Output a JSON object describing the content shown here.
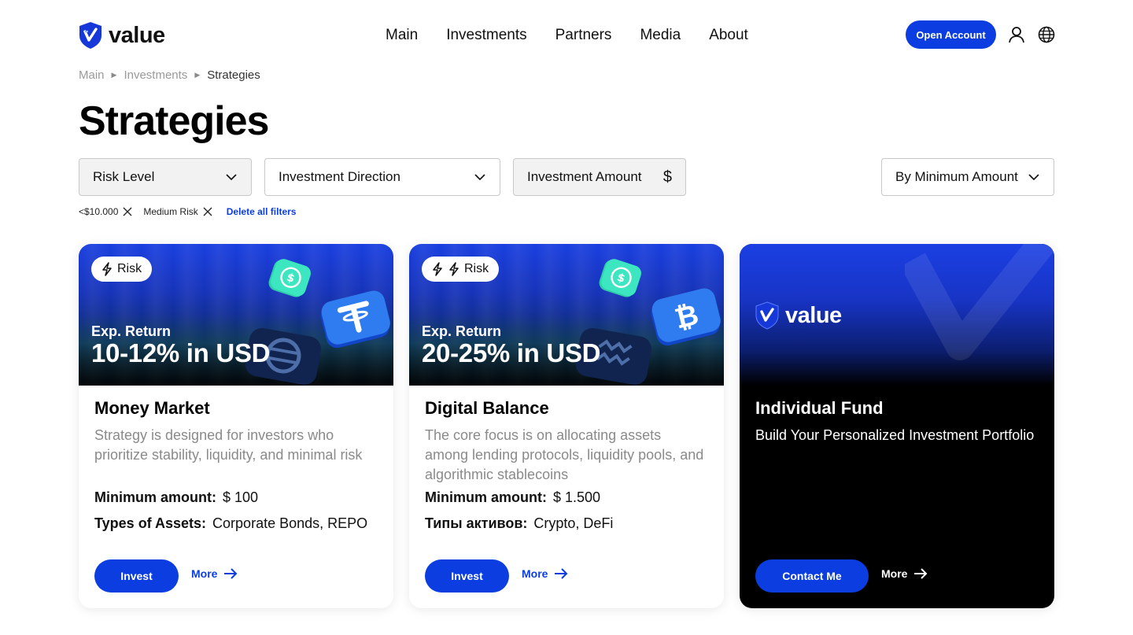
{
  "header": {
    "brand": "value",
    "nav": [
      "Main",
      "Investments",
      "Partners",
      "Media",
      "About"
    ],
    "open_account": "Open Account",
    "accent_color": "#0b3de1"
  },
  "breadcrumb": {
    "items": [
      "Main",
      "Investments",
      "Strategies"
    ]
  },
  "page_title": "Strategies",
  "filters": {
    "risk_level": "Risk Level",
    "investment_direction": "Investment Direction",
    "investment_amount": "Investment Amount",
    "currency_symbol": "$",
    "sort": "By Minimum Amount"
  },
  "active_filters": {
    "chips": [
      "<$10.000",
      "Medium Risk"
    ],
    "delete_all": "Delete all filters"
  },
  "cards": [
    {
      "risk_label": "Risk",
      "risk_bolts": 1,
      "exp_label": "Exp. Return",
      "exp_value": "10-12% in USD",
      "title": "Money Market",
      "description": "Strategy is designed for investors who prioritize stability, liquidity, and minimal risk",
      "min_label": "Minimum amount:",
      "min_value": "$ 100",
      "assets_label": "Types of Assets:",
      "assets_value": "Corporate Bonds, REPO",
      "invest": "Invest",
      "more": "More"
    },
    {
      "risk_label": "Risk",
      "risk_bolts": 2,
      "exp_label": "Exp. Return",
      "exp_value": "20-25% in USD",
      "title": "Digital Balance",
      "description": "The core focus is on allocating assets among lending protocols, liquidity pools, and algorithmic stablecoins",
      "min_label": "Minimum amount:",
      "min_value": "$ 1.500",
      "assets_label": "Типы активов:",
      "assets_value": "Crypto, DeFi",
      "invest": "Invest",
      "more": "More"
    },
    {
      "brand": "value",
      "title": "Individual Fund",
      "description": "Build Your Personalized Investment Portfolio",
      "contact": "Contact Me",
      "more": "More"
    }
  ]
}
